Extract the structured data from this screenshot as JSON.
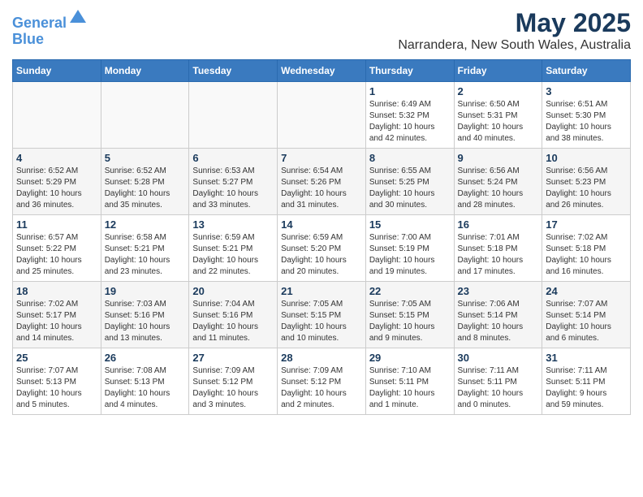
{
  "header": {
    "logo_line1": "General",
    "logo_line2": "Blue",
    "month": "May 2025",
    "location": "Narrandera, New South Wales, Australia"
  },
  "weekdays": [
    "Sunday",
    "Monday",
    "Tuesday",
    "Wednesday",
    "Thursday",
    "Friday",
    "Saturday"
  ],
  "weeks": [
    [
      {
        "day": "",
        "info": ""
      },
      {
        "day": "",
        "info": ""
      },
      {
        "day": "",
        "info": ""
      },
      {
        "day": "",
        "info": ""
      },
      {
        "day": "1",
        "info": "Sunrise: 6:49 AM\nSunset: 5:32 PM\nDaylight: 10 hours\nand 42 minutes."
      },
      {
        "day": "2",
        "info": "Sunrise: 6:50 AM\nSunset: 5:31 PM\nDaylight: 10 hours\nand 40 minutes."
      },
      {
        "day": "3",
        "info": "Sunrise: 6:51 AM\nSunset: 5:30 PM\nDaylight: 10 hours\nand 38 minutes."
      }
    ],
    [
      {
        "day": "4",
        "info": "Sunrise: 6:52 AM\nSunset: 5:29 PM\nDaylight: 10 hours\nand 36 minutes."
      },
      {
        "day": "5",
        "info": "Sunrise: 6:52 AM\nSunset: 5:28 PM\nDaylight: 10 hours\nand 35 minutes."
      },
      {
        "day": "6",
        "info": "Sunrise: 6:53 AM\nSunset: 5:27 PM\nDaylight: 10 hours\nand 33 minutes."
      },
      {
        "day": "7",
        "info": "Sunrise: 6:54 AM\nSunset: 5:26 PM\nDaylight: 10 hours\nand 31 minutes."
      },
      {
        "day": "8",
        "info": "Sunrise: 6:55 AM\nSunset: 5:25 PM\nDaylight: 10 hours\nand 30 minutes."
      },
      {
        "day": "9",
        "info": "Sunrise: 6:56 AM\nSunset: 5:24 PM\nDaylight: 10 hours\nand 28 minutes."
      },
      {
        "day": "10",
        "info": "Sunrise: 6:56 AM\nSunset: 5:23 PM\nDaylight: 10 hours\nand 26 minutes."
      }
    ],
    [
      {
        "day": "11",
        "info": "Sunrise: 6:57 AM\nSunset: 5:22 PM\nDaylight: 10 hours\nand 25 minutes."
      },
      {
        "day": "12",
        "info": "Sunrise: 6:58 AM\nSunset: 5:21 PM\nDaylight: 10 hours\nand 23 minutes."
      },
      {
        "day": "13",
        "info": "Sunrise: 6:59 AM\nSunset: 5:21 PM\nDaylight: 10 hours\nand 22 minutes."
      },
      {
        "day": "14",
        "info": "Sunrise: 6:59 AM\nSunset: 5:20 PM\nDaylight: 10 hours\nand 20 minutes."
      },
      {
        "day": "15",
        "info": "Sunrise: 7:00 AM\nSunset: 5:19 PM\nDaylight: 10 hours\nand 19 minutes."
      },
      {
        "day": "16",
        "info": "Sunrise: 7:01 AM\nSunset: 5:18 PM\nDaylight: 10 hours\nand 17 minutes."
      },
      {
        "day": "17",
        "info": "Sunrise: 7:02 AM\nSunset: 5:18 PM\nDaylight: 10 hours\nand 16 minutes."
      }
    ],
    [
      {
        "day": "18",
        "info": "Sunrise: 7:02 AM\nSunset: 5:17 PM\nDaylight: 10 hours\nand 14 minutes."
      },
      {
        "day": "19",
        "info": "Sunrise: 7:03 AM\nSunset: 5:16 PM\nDaylight: 10 hours\nand 13 minutes."
      },
      {
        "day": "20",
        "info": "Sunrise: 7:04 AM\nSunset: 5:16 PM\nDaylight: 10 hours\nand 11 minutes."
      },
      {
        "day": "21",
        "info": "Sunrise: 7:05 AM\nSunset: 5:15 PM\nDaylight: 10 hours\nand 10 minutes."
      },
      {
        "day": "22",
        "info": "Sunrise: 7:05 AM\nSunset: 5:15 PM\nDaylight: 10 hours\nand 9 minutes."
      },
      {
        "day": "23",
        "info": "Sunrise: 7:06 AM\nSunset: 5:14 PM\nDaylight: 10 hours\nand 8 minutes."
      },
      {
        "day": "24",
        "info": "Sunrise: 7:07 AM\nSunset: 5:14 PM\nDaylight: 10 hours\nand 6 minutes."
      }
    ],
    [
      {
        "day": "25",
        "info": "Sunrise: 7:07 AM\nSunset: 5:13 PM\nDaylight: 10 hours\nand 5 minutes."
      },
      {
        "day": "26",
        "info": "Sunrise: 7:08 AM\nSunset: 5:13 PM\nDaylight: 10 hours\nand 4 minutes."
      },
      {
        "day": "27",
        "info": "Sunrise: 7:09 AM\nSunset: 5:12 PM\nDaylight: 10 hours\nand 3 minutes."
      },
      {
        "day": "28",
        "info": "Sunrise: 7:09 AM\nSunset: 5:12 PM\nDaylight: 10 hours\nand 2 minutes."
      },
      {
        "day": "29",
        "info": "Sunrise: 7:10 AM\nSunset: 5:11 PM\nDaylight: 10 hours\nand 1 minute."
      },
      {
        "day": "30",
        "info": "Sunrise: 7:11 AM\nSunset: 5:11 PM\nDaylight: 10 hours\nand 0 minutes."
      },
      {
        "day": "31",
        "info": "Sunrise: 7:11 AM\nSunset: 5:11 PM\nDaylight: 9 hours\nand 59 minutes."
      }
    ]
  ]
}
